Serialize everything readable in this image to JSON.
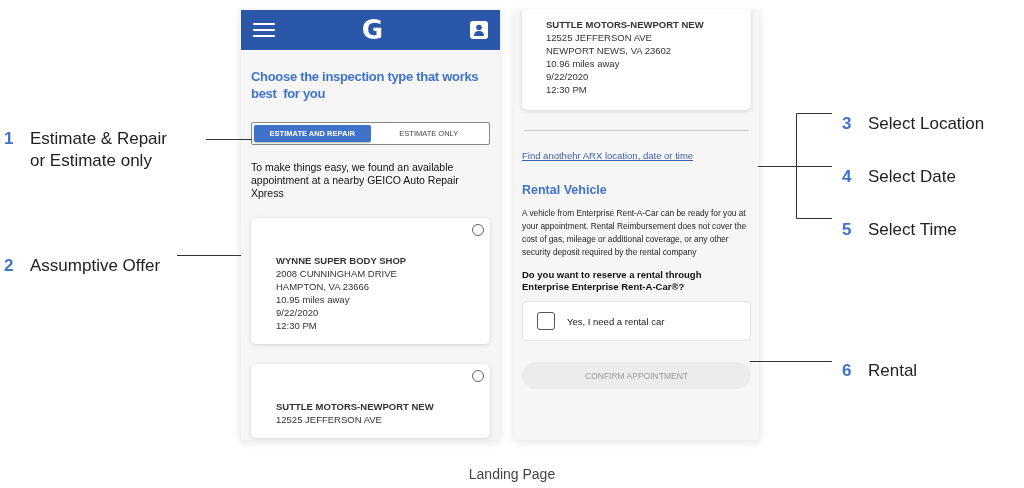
{
  "left_annotations": [
    {
      "number": "1",
      "label": "Estimate & Repair or Estimate only"
    },
    {
      "number": "2",
      "label": "Assumptive Offer"
    }
  ],
  "left_screen": {
    "logo": "G",
    "title": "Choose the inspection type that works best  for you",
    "toggle": [
      {
        "label": "ESTIMATE AND REPAIR",
        "selected": true
      },
      {
        "label": "ESTIMATE ONLY",
        "selected": false
      }
    ],
    "intro": "To make things easy, we found an available appointment at a nearby GEICO Auto Repair Xpress",
    "offers": [
      {
        "selected": false,
        "name": "WYNNE SUPER BODY SHOP",
        "lines": [
          "2008 CUNNINGHAM DRIVE",
          "HAMPTON, VA 23666",
          "10.95 miles away",
          "9/22/2020",
          "12:30 PM"
        ]
      },
      {
        "selected": false,
        "name": "SUTTLE MOTORS-NEWPORT NEW",
        "lines": [
          "12525 JEFFERSON AVE"
        ]
      }
    ]
  },
  "right_screen": {
    "offer": {
      "name": "SUTTLE MOTORS-NEWPORT NEW",
      "lines": [
        "12525 JEFFERSON AVE",
        "NEWPORT NEWS, VA 23602",
        "10.96 miles away",
        "9/22/2020",
        "12:30 PM"
      ]
    },
    "link": "Find anothehr ARX location, date or  time",
    "rental_heading": "Rental Vehicle",
    "rental_text": "A vehicle from Enterprise Rent-A-Car can be ready for you at your appointment. Rental Reimbursement does not cover the cost of gas, mileage or additional coverage, or any other security deposit required by the rental company",
    "question": "Do you want to reserve a rental through Enterprise Enterprise Rent-A-Car®?",
    "rental_option": {
      "label": "Yes, I need a rental car",
      "checked": false
    },
    "confirm_button": {
      "label": "CONFIRM APPOINTMENT",
      "disabled": true
    }
  },
  "right_annotations": [
    {
      "number": "3",
      "label": "Select Location"
    },
    {
      "number": "4",
      "label": "Select Date"
    },
    {
      "number": "5",
      "label": "Select Time"
    },
    {
      "number": "6",
      "label": "Rental"
    }
  ],
  "caption": "Landing Page"
}
